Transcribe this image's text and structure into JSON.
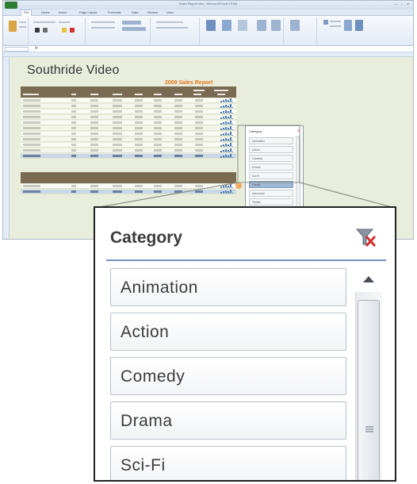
{
  "excel": {
    "window_title": "Sales Report.xlsx - Microsoft Excel (Trial)",
    "tabs": [
      "File",
      "Home",
      "Insert",
      "Page Layout",
      "Formulas",
      "Data",
      "Review",
      "View"
    ],
    "sheet_heading": "Southride Video",
    "report_title": "2009 Sales Report",
    "mini_slicer": {
      "title": "Category",
      "items": [
        "Animation",
        "Action",
        "Comedy",
        "Drama",
        "Sci-Fi",
        "Family",
        "Adventure",
        "Thriller"
      ],
      "selected_index": 5
    }
  },
  "slicer": {
    "title": "Category",
    "clear_filter_icon": "clear-filter-icon",
    "items": [
      {
        "label": "Animation"
      },
      {
        "label": "Action"
      },
      {
        "label": "Comedy"
      },
      {
        "label": "Drama"
      },
      {
        "label": "Sci-Fi"
      }
    ],
    "scroll_up_icon": "triangle-up-icon",
    "thumb_grip_icon": "grip-lines-icon"
  },
  "colors": {
    "sheet_background": "#e9eddc",
    "table_header": "#7a6a52",
    "report_title": "#e1751d",
    "slicer_rule": "#6f94c0",
    "selected_item": "#9fb9d6",
    "clear_filter_x": "#d0312d"
  }
}
